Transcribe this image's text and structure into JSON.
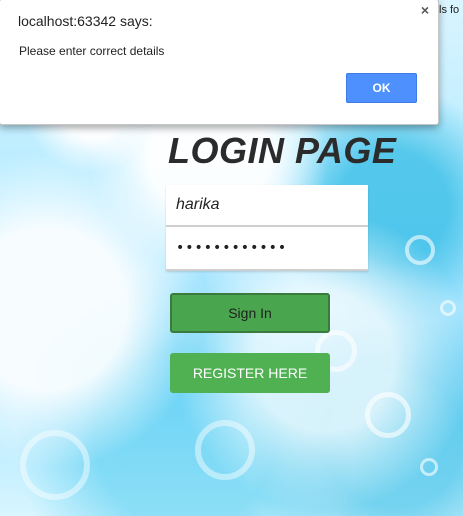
{
  "browser": {
    "clipped_right_text": "ls fo"
  },
  "alert": {
    "title": "localhost:63342 says:",
    "close_label": "×",
    "message": "Please enter correct details",
    "ok_label": "OK",
    "ok_color": "#4d90fe"
  },
  "login": {
    "title": "LOGIN PAGE",
    "username_value": "harika",
    "password_value": "••••••••••••",
    "sign_in_label": "Sign In",
    "register_label": "REGISTER HERE",
    "primary_green": "#4aa64e"
  }
}
